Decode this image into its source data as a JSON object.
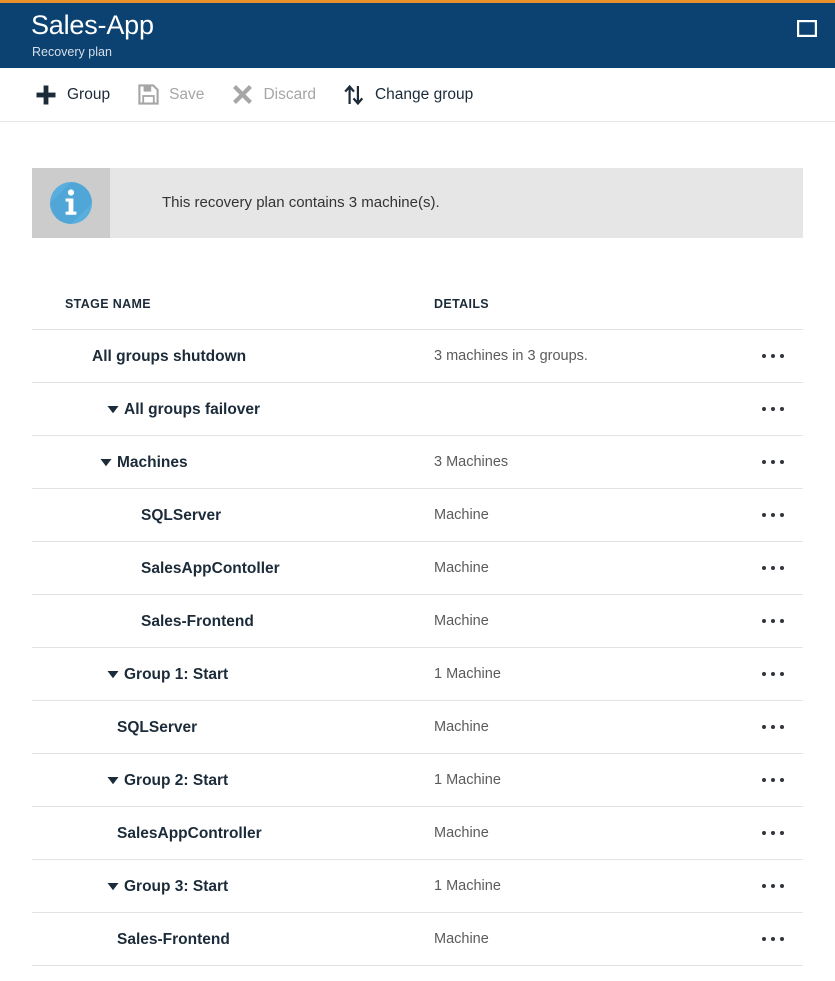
{
  "theme": {
    "accent_strip": "#e8912a",
    "header_bg": "#0b4271",
    "info_bg": "#e6e6e6",
    "info_icon_bg": "#cccccc",
    "info_icon_color": "#58aedc"
  },
  "header": {
    "title": "Sales-App",
    "subtitle": "Recovery plan",
    "window_action_icon": "maximize-icon"
  },
  "toolbar": {
    "commands": [
      {
        "label": "Group",
        "icon": "plus-icon",
        "disabled": false
      },
      {
        "label": "Save",
        "icon": "save-icon",
        "disabled": true
      },
      {
        "label": "Discard",
        "icon": "close-x-icon",
        "disabled": true
      },
      {
        "label": "Change group",
        "icon": "sort-arrows-icon",
        "disabled": false
      }
    ]
  },
  "info_banner": {
    "icon": "info-circle-icon",
    "message": "This recovery plan contains 3 machine(s)."
  },
  "grid": {
    "columns": {
      "stage_name": "STAGE NAME",
      "details": "DETAILS"
    },
    "row_action_icon": "ellipsis-icon",
    "rows": [
      {
        "name": "All groups shutdown",
        "details": "3 machines in 3 groups.",
        "indent": 1,
        "caret": false,
        "bold": true
      },
      {
        "name": "All groups failover",
        "details": "",
        "indent": 4,
        "caret": true,
        "bold": true
      },
      {
        "name": "Machines",
        "details": "3 Machines",
        "indent": 2,
        "caret": true,
        "bold": true
      },
      {
        "name": "SQLServer",
        "details": "Machine",
        "indent": 3,
        "caret": false,
        "bold": true
      },
      {
        "name": "SalesAppContoller",
        "details": "Machine",
        "indent": 3,
        "caret": false,
        "bold": true
      },
      {
        "name": "Sales-Frontend",
        "details": "Machine",
        "indent": 3,
        "caret": false,
        "bold": true
      },
      {
        "name": "Group 1: Start",
        "details": "1 Machine",
        "indent": 4,
        "caret": true,
        "bold": true
      },
      {
        "name": "SQLServer",
        "details": "Machine",
        "indent": 2,
        "caret": false,
        "bold": true
      },
      {
        "name": "Group 2: Start",
        "details": "1 Machine",
        "indent": 4,
        "caret": true,
        "bold": true
      },
      {
        "name": "SalesAppController",
        "details": "Machine",
        "indent": 2,
        "caret": false,
        "bold": true
      },
      {
        "name": "Group 3: Start",
        "details": "1 Machine",
        "indent": 4,
        "caret": true,
        "bold": true
      },
      {
        "name": "Sales-Frontend",
        "details": "Machine",
        "indent": 2,
        "caret": false,
        "bold": true
      }
    ]
  }
}
